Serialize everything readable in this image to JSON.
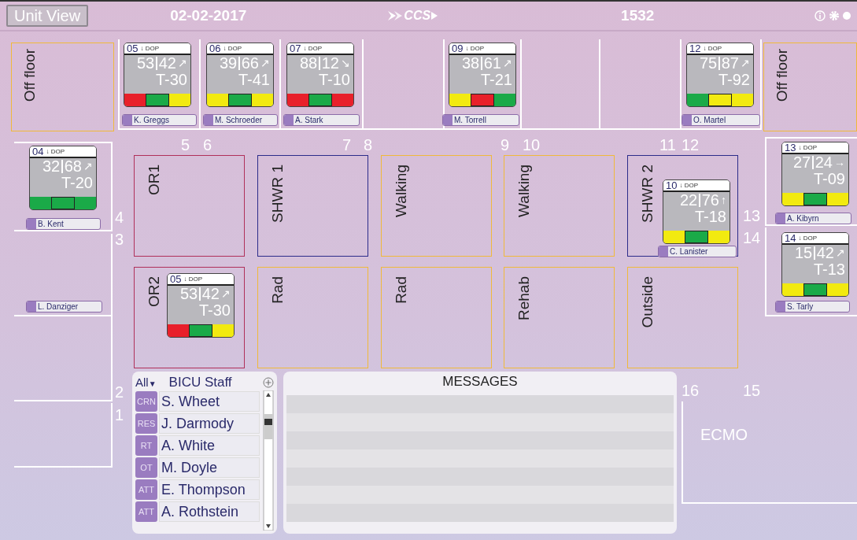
{
  "header": {
    "button": "Unit View",
    "date": "02-02-2017",
    "logo": "CCS",
    "census": "1532"
  },
  "off_floor": [
    {
      "label": "Off floor"
    },
    {
      "label": "Off floor"
    }
  ],
  "top_beds": [
    {
      "number": "5",
      "patient": {
        "name": "K. Greggs",
        "card": {
          "bed": "05",
          "drip": "↓ DOP",
          "vital_1": "53",
          "vital_2": "42",
          "trend": "↗",
          "t_value": "T-30",
          "indicators": [
            {
              "color": "#e8202a"
            },
            {
              "color": "#1aaa48"
            },
            {
              "color": "#f2ea10"
            }
          ]
        }
      }
    },
    {
      "number": "6",
      "patient": {
        "name": "M. Schroeder",
        "card": {
          "bed": "06",
          "drip": "↓ DOP",
          "vital_1": "39",
          "vital_2": "66",
          "trend": "↗",
          "t_value": "T-41",
          "indicators": [
            {
              "color": "#f2ea10"
            },
            {
              "color": "#1aaa48"
            },
            {
              "color": "#f2ea10"
            }
          ]
        }
      }
    },
    {
      "number": "7",
      "patient": {
        "name": "A. Stark",
        "card": {
          "bed": "07",
          "drip": "↓ DOP",
          "vital_1": "88",
          "vital_2": "12",
          "trend": "↘",
          "t_value": "T-10",
          "indicators": [
            {
              "color": "#e8202a"
            },
            {
              "color": "#1aaa48"
            },
            {
              "color": "#e8202a"
            }
          ]
        }
      }
    },
    {
      "number": "8"
    },
    {
      "number": "9",
      "patient": {
        "name": "M. Torrell",
        "card": {
          "bed": "09",
          "drip": "↓ DOP",
          "vital_1": "38",
          "vital_2": "61",
          "trend": "↗",
          "t_value": "T-21",
          "indicators": [
            {
              "color": "#f2ea10"
            },
            {
              "color": "#e8202a"
            },
            {
              "color": "#1aaa48"
            }
          ]
        }
      }
    },
    {
      "number": "10"
    },
    {
      "number": "11"
    },
    {
      "number": "12",
      "patient": {
        "name": "O. Martel",
        "card": {
          "bed": "12",
          "drip": "↓ DOP",
          "vital_1": "75",
          "vital_2": "87",
          "trend": "↗",
          "t_value": "T-92",
          "indicators": [
            {
              "color": "#1aaa48"
            },
            {
              "color": "#f2ea10"
            },
            {
              "color": "#f2ea10"
            }
          ]
        }
      }
    }
  ],
  "left_beds": [
    {
      "number": "4",
      "patient": {
        "name": "B. Kent",
        "card": {
          "bed": "04",
          "drip": "↓ DOP",
          "vital_1": "32",
          "vital_2": "68",
          "trend": "↗",
          "t_value": "T-20",
          "indicators": [
            {
              "color": "#1aaa48"
            },
            {
              "color": "#1aaa48"
            },
            {
              "color": "#1aaa48"
            }
          ]
        }
      }
    },
    {
      "number": "3",
      "patient": {
        "name": "L. Danziger"
      }
    },
    {
      "number": "2"
    },
    {
      "number": "1"
    }
  ],
  "right_beds": [
    {
      "number": "13",
      "patient": {
        "name": "A. Kibyrn",
        "card": {
          "bed": "13",
          "drip": "↓ DOP",
          "vital_1": "27",
          "vital_2": "24",
          "trend": "→",
          "t_value": "T-09",
          "indicators": [
            {
              "color": "#f2ea10"
            },
            {
              "color": "#1aaa48"
            },
            {
              "color": "#f2ea10"
            }
          ]
        }
      }
    },
    {
      "number": "14",
      "patient": {
        "name": "S. Tarly",
        "card": {
          "bed": "14",
          "drip": "↓ DOP",
          "vital_1": "15",
          "vital_2": "42",
          "trend": "↗",
          "t_value": "T-13",
          "indicators": [
            {
              "color": "#f2ea10"
            },
            {
              "color": "#1aaa48"
            },
            {
              "color": "#f2ea10"
            }
          ]
        }
      }
    },
    {
      "number": "16"
    },
    {
      "number": "15",
      "label": "ECMO"
    }
  ],
  "center_rooms": [
    {
      "label": "OR1",
      "color": "#b0305a"
    },
    {
      "label": "SHWR 1",
      "color": "#2c2c8a"
    },
    {
      "label": "Walking",
      "color": "#f0b93a"
    },
    {
      "label": "Walking",
      "color": "#f0b93a"
    },
    {
      "label": "SHWR 2",
      "color": "#2c2c8a",
      "patient": {
        "name": "C. Lanister",
        "card": {
          "bed": "10",
          "drip": "↓ DOP",
          "vital_1": "22",
          "vital_2": "76",
          "trend": "↑",
          "t_value": "T-18",
          "indicators": [
            {
              "color": "#f2ea10"
            },
            {
              "color": "#1aaa48"
            },
            {
              "color": "#f2ea10"
            }
          ]
        }
      }
    },
    {
      "label": "OR2",
      "color": "#b0305a",
      "patient": {
        "card": {
          "bed": "05",
          "drip": "↓ DOP",
          "vital_1": "53",
          "vital_2": "42",
          "trend": "↗",
          "t_value": "T-30",
          "indicators": [
            {
              "color": "#e8202a"
            },
            {
              "color": "#1aaa48"
            },
            {
              "color": "#f2ea10"
            }
          ]
        }
      }
    },
    {
      "label": "Rad",
      "color": "#f0b93a"
    },
    {
      "label": "Rad",
      "color": "#f0b93a"
    },
    {
      "label": "Rehab",
      "color": "#f0b93a"
    },
    {
      "label": "Outside",
      "color": "#f0b93a"
    }
  ],
  "staff": {
    "filter": "All",
    "filter_caret": "▼",
    "title": "BICU Staff",
    "members": [
      {
        "role": "CRN",
        "name": "S. Wheet"
      },
      {
        "role": "RES",
        "name": "J. Darmody"
      },
      {
        "role": "RT",
        "name": "A. White"
      },
      {
        "role": "OT",
        "name": "M. Doyle"
      },
      {
        "role": "ATT",
        "name": "E. Thompson"
      },
      {
        "role": "ATT",
        "name": "A. Rothstein"
      }
    ]
  },
  "messages": {
    "title": "MESSAGES"
  }
}
